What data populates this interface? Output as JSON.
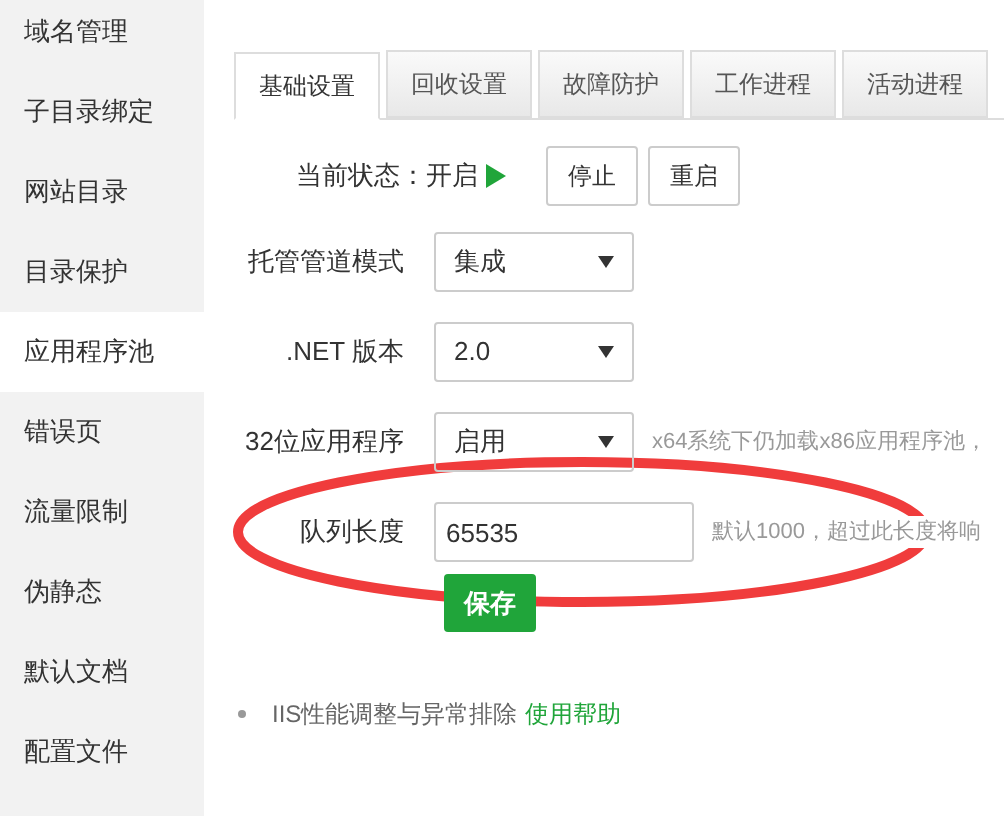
{
  "sidebar": {
    "items": [
      {
        "label": "域名管理",
        "selected": false
      },
      {
        "label": "子目录绑定",
        "selected": false
      },
      {
        "label": "网站目录",
        "selected": false
      },
      {
        "label": "目录保护",
        "selected": false
      },
      {
        "label": "应用程序池",
        "selected": true
      },
      {
        "label": "错误页",
        "selected": false
      },
      {
        "label": "流量限制",
        "selected": false
      },
      {
        "label": "伪静态",
        "selected": false
      },
      {
        "label": "默认文档",
        "selected": false
      },
      {
        "label": "配置文件",
        "selected": false
      }
    ]
  },
  "tabs": [
    {
      "label": "基础设置",
      "selected": true
    },
    {
      "label": "回收设置",
      "selected": false
    },
    {
      "label": "故障防护",
      "selected": false
    },
    {
      "label": "工作进程",
      "selected": false
    },
    {
      "label": "活动进程",
      "selected": false
    }
  ],
  "status": {
    "label": "当前状态：",
    "value": "开启",
    "running": true,
    "buttons": [
      "停止",
      "重启"
    ]
  },
  "fields": [
    {
      "kind": "select",
      "label": "托管管道模式",
      "value": "集成"
    },
    {
      "kind": "select",
      "label": ".NET 版本",
      "value": "2.0"
    },
    {
      "kind": "select",
      "label": "32位应用程序",
      "value": "启用",
      "hint": "x64系统下仍加载x86应用程序池，"
    },
    {
      "kind": "input",
      "label": "队列长度",
      "value": "65535",
      "hint": "默认1000，超过此长度将响"
    }
  ],
  "save_button": "保存",
  "help": {
    "text": "IIS性能调整与异常排除",
    "link": "使用帮助"
  }
}
